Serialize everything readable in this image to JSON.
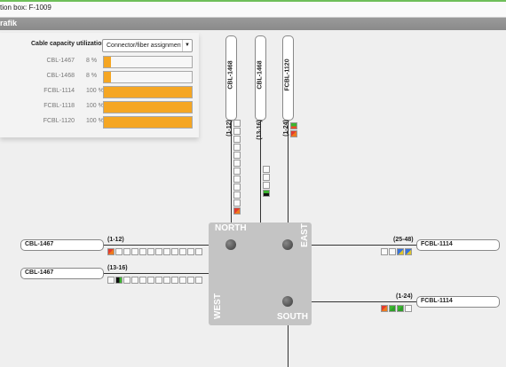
{
  "topbar": {
    "text": "tion box: F-1009"
  },
  "panel_title": "rafik",
  "utilization": {
    "heading": "Cable capacity utilization",
    "select_value": "Connector/fiber assignment ra",
    "rows": [
      {
        "name": "CBL-1467",
        "percent": "8 %",
        "value": 0.08
      },
      {
        "name": "CBL-1468",
        "percent": "8 %",
        "value": 0.08
      },
      {
        "name": "FCBL-1114",
        "percent": "100 %",
        "value": 1.0
      },
      {
        "name": "FCBL-1118",
        "percent": "100 %",
        "value": 1.0
      },
      {
        "name": "FCBL-1120",
        "percent": "100 %",
        "value": 1.0
      }
    ]
  },
  "diagram": {
    "directions": {
      "north": "NORTH",
      "east": "EAST",
      "south": "SOUTH",
      "west": "WEST"
    },
    "cables": {
      "top1": {
        "name": "CBL-1468",
        "range": "(1-12)"
      },
      "top2": {
        "name": "CBL-1468",
        "range": "(13-16)"
      },
      "top3": {
        "name": "FCBL-1120",
        "range": "(1-24)"
      },
      "left1": {
        "name": "CBL-1467",
        "range": "(1-12)"
      },
      "left2": {
        "name": "CBL-1467",
        "range": "(13-16)"
      },
      "right1": {
        "name": "FCBL-1114",
        "range": "(25-48)"
      },
      "right2": {
        "name": "FCBL-1114",
        "range": "(1-24)"
      }
    }
  }
}
